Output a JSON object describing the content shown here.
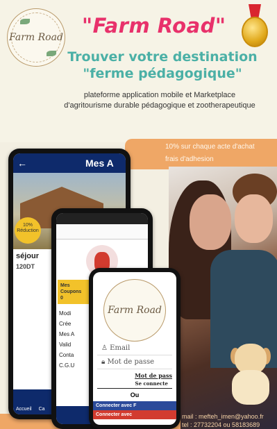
{
  "header": {
    "logo_text": "Farm Road",
    "brand": "\"Farm Road\"",
    "headline_line1": "Trouver votre destination",
    "headline_line2": "\"ferme pédagogique\"",
    "subtitle": "plateforme application mobile et Marketplace d'agritourisme durable pédagogique et zootherapeutique"
  },
  "offer": {
    "line1": "10% sur chaque acte d'achat",
    "line2": "frais d'adhesion"
  },
  "contact": {
    "mail": "mail : mefteh_imen@yahoo.fr",
    "tel": "tel : 27732204 ou 58183689"
  },
  "phone1": {
    "title": "Mes A",
    "badge": "10% Réduction",
    "sejour": "séjour",
    "price": "120DT",
    "nav_items": [
      "Accueil",
      "Ca"
    ]
  },
  "phone2": {
    "coupons": "Mes Coupons",
    "coupons_count": "0",
    "menu": [
      "Modi",
      "Crée",
      "Mes A",
      "Valid",
      "Conta",
      "C.G.U"
    ]
  },
  "phone3": {
    "logo_text": "Farm Road",
    "email_label": "Email",
    "password_label": "Mot de passe",
    "forgot": "Mot de pass",
    "connect": "Se connecte",
    "or": "Ou",
    "facebook": "Connecter avec F",
    "google": "Connecter avec"
  },
  "colors": {
    "brand_pink": "#e8316b",
    "teal": "#4bb0a6",
    "orange": "#efa766",
    "navy": "#0e2a6b"
  }
}
